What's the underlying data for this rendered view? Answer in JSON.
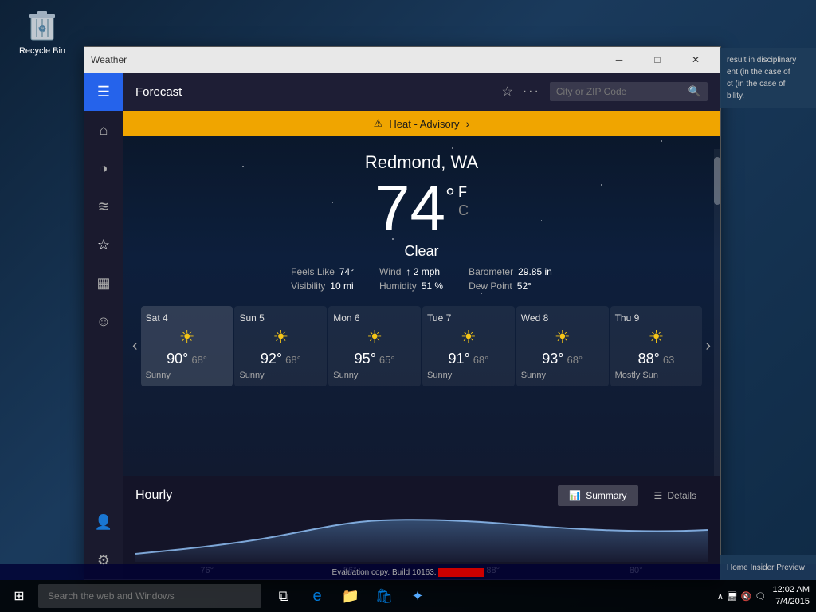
{
  "desktop": {
    "recycle_bin_label": "Recycle Bin"
  },
  "titlebar": {
    "title": "Weather",
    "minimize_label": "─",
    "maximize_label": "□",
    "close_label": "✕"
  },
  "topbar": {
    "title": "Forecast",
    "search_placeholder": "City or ZIP Code"
  },
  "advisory": {
    "text": "Heat - Advisory",
    "icon": "⚠"
  },
  "current": {
    "city": "Redmond, WA",
    "temp": "74",
    "deg_symbol": "°",
    "unit_f": "F",
    "unit_c": "C",
    "condition": "Clear",
    "feels_like_label": "Feels Like",
    "feels_like_value": "74°",
    "wind_label": "Wind",
    "wind_value": "↑ 2 mph",
    "barometer_label": "Barometer",
    "barometer_value": "29.85 in",
    "visibility_label": "Visibility",
    "visibility_value": "10 mi",
    "humidity_label": "Humidity",
    "humidity_value": "51 %",
    "dew_point_label": "Dew Point",
    "dew_point_value": "52°"
  },
  "forecast": {
    "days": [
      {
        "name": "Sat 4",
        "hi": "90°",
        "lo": "68°",
        "desc": "Sunny",
        "active": true
      },
      {
        "name": "Sun 5",
        "hi": "92°",
        "lo": "68°",
        "desc": "Sunny",
        "active": false
      },
      {
        "name": "Mon 6",
        "hi": "95°",
        "lo": "65°",
        "desc": "Sunny",
        "active": false
      },
      {
        "name": "Tue 7",
        "hi": "91°",
        "lo": "68°",
        "desc": "Sunny",
        "active": false
      },
      {
        "name": "Wed 8",
        "hi": "93°",
        "lo": "68°",
        "desc": "Sunny",
        "active": false
      },
      {
        "name": "Thu 9",
        "hi": "88°",
        "lo": "63",
        "desc": "Mostly Sun",
        "active": false
      }
    ]
  },
  "hourly": {
    "title": "Hourly",
    "summary_label": "Summary",
    "details_label": "Details",
    "chart_values": [
      "76°",
      "86°",
      "88°",
      "80°"
    ]
  },
  "sidebar": {
    "icons": [
      "☰",
      "⌂",
      "◌",
      "≋",
      "☆",
      "▦",
      "☺"
    ]
  },
  "taskbar": {
    "search_placeholder": "Search the web and Windows",
    "time": "12:02 AM",
    "date": "7/4/2015",
    "start_icon": "⊞"
  },
  "eval_bar": {
    "text": "Evaluation copy. Build 10163.",
    "censored": "censored"
  },
  "side_panel": {
    "line1": "result in disciplinary",
    "line2": "ent (in the case of",
    "line3": "ct (in the case of",
    "line4": "bility.",
    "bottom": "Home Insider Preview"
  }
}
